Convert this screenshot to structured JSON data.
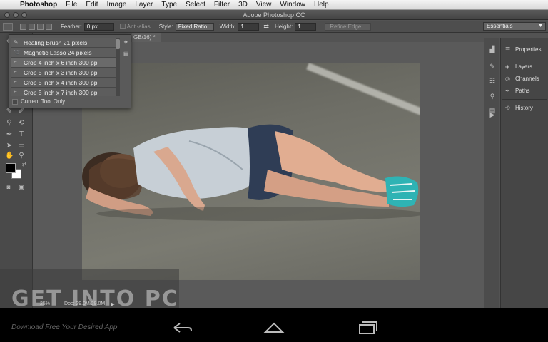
{
  "menubar": {
    "apple_glyph": "",
    "items": [
      "Photoshop",
      "File",
      "Edit",
      "Image",
      "Layer",
      "Type",
      "Select",
      "Filter",
      "3D",
      "View",
      "Window",
      "Help"
    ]
  },
  "window": {
    "title": "Adobe Photoshop CC"
  },
  "options_bar": {
    "feather_label": "Feather:",
    "feather_value": "0 px",
    "anti_alias_label": "Anti-alias",
    "style_label": "Style:",
    "style_value": "Fixed Ratio",
    "width_label": "Width:",
    "width_value": "1",
    "swap_glyph": "⇄",
    "height_label": "Height:",
    "height_value": "1",
    "refine_edge_label": "Refine Edge...",
    "workspace_value": "Essentials"
  },
  "document": {
    "tab_title": "GB/16) *"
  },
  "preset_picker": {
    "items": [
      "Healing Brush 21 pixels",
      "Magnetic Lasso 24 pixels",
      "Crop 4 inch x 6 inch 300 ppi",
      "Crop 5 inch x 3 inch 300 ppi",
      "Crop 5 inch x 4 inch 300 ppi",
      "Crop 5 inch x 7 inch 300 ppi"
    ],
    "current_tool_only_label": "Current Tool Only"
  },
  "panels": {
    "properties_label": "Properties",
    "layers_label": "Layers",
    "channels_label": "Channels",
    "paths_label": "Paths",
    "history_label": "History"
  },
  "status_bar": {
    "zoom": "25%",
    "doc_size": "Doc: 29.0M/29.0M"
  },
  "watermark": {
    "text": "GET INTO PC",
    "tagline": "Download Free Your Desired App"
  },
  "colors": {
    "foreground": "#000000",
    "background": "#ffffff",
    "ui_panel": "#535353"
  }
}
